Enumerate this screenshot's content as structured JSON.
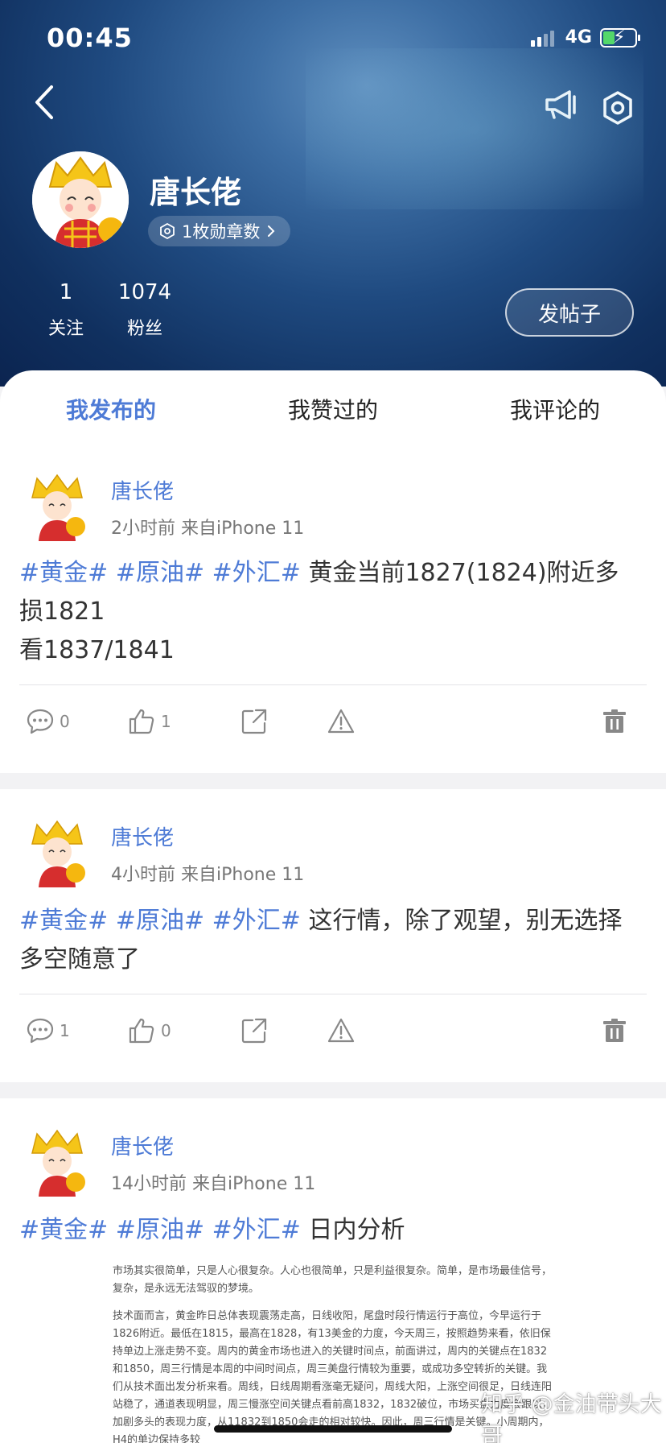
{
  "status": {
    "time": "00:45",
    "network": "4G"
  },
  "profile": {
    "name": "唐长佬",
    "badge_text": "1枚勋章数",
    "following_count": "1",
    "following_label": "关注",
    "followers_count": "1074",
    "followers_label": "粉丝",
    "post_button": "发帖子"
  },
  "tabs": [
    {
      "label": "我发布的",
      "active": true
    },
    {
      "label": "我赞过的",
      "active": false
    },
    {
      "label": "我评论的",
      "active": false
    }
  ],
  "posts": [
    {
      "author": "唐长佬",
      "meta": "2小时前  来自iPhone 11",
      "tags": "#黄金# #原油# #外汇#",
      "line1": " 黄金当前1827(1824)附近多",
      "line2": "损1821",
      "line3": "看1837/1841",
      "comments": "0",
      "likes": "1"
    },
    {
      "author": "唐长佬",
      "meta": "4小时前  来自iPhone 11",
      "tags": "#黄金# #原油# #外汇#",
      "line1": " 这行情，除了观望，别无选择",
      "line2": "多空随意了",
      "comments": "1",
      "likes": "0"
    },
    {
      "author": "唐长佬",
      "meta": "14小时前  来自iPhone 11",
      "tags": "#黄金# #原油# #外汇#",
      "line1": " 日内分析",
      "article_p1": "市场其实很简单，只是人心很复杂。人心也很简单，只是利益很复杂。简单，是市场最佳信号，复杂，是永远无法驾驭的梦境。",
      "article_p2": "技术面而言，黄金昨日总体表现震荡走高，日线收阳，尾盘时段行情运行于高位，今早运行于1826附近。最低在1815，最高在1828，有13美金的力度，今天周三，按照趋势来看，依旧保持单边上涨走势不变。周内的黄金市场也进入的关键时间点，前面讲过，周内的关键点在1832和1850，周三行情是本周的中间时间点，周三美盘行情较为重要，或成功多空转折的关键。我们从技术面出发分析来看。周线，日线周期看涨毫无疑问，周线大阳，上涨空间很足，日线连阳站稳了，通道表现明显，周三慢涨空间关键点看前高1832，1832破位，市场买盘力度会跟以，加剧多头的表现力度，从11832到1850会走的相对较快。因此，周三行情是关键。小周期内，H4的单边保持多较"
    }
  ],
  "watermark": "知乎 @金油带头大哥"
}
